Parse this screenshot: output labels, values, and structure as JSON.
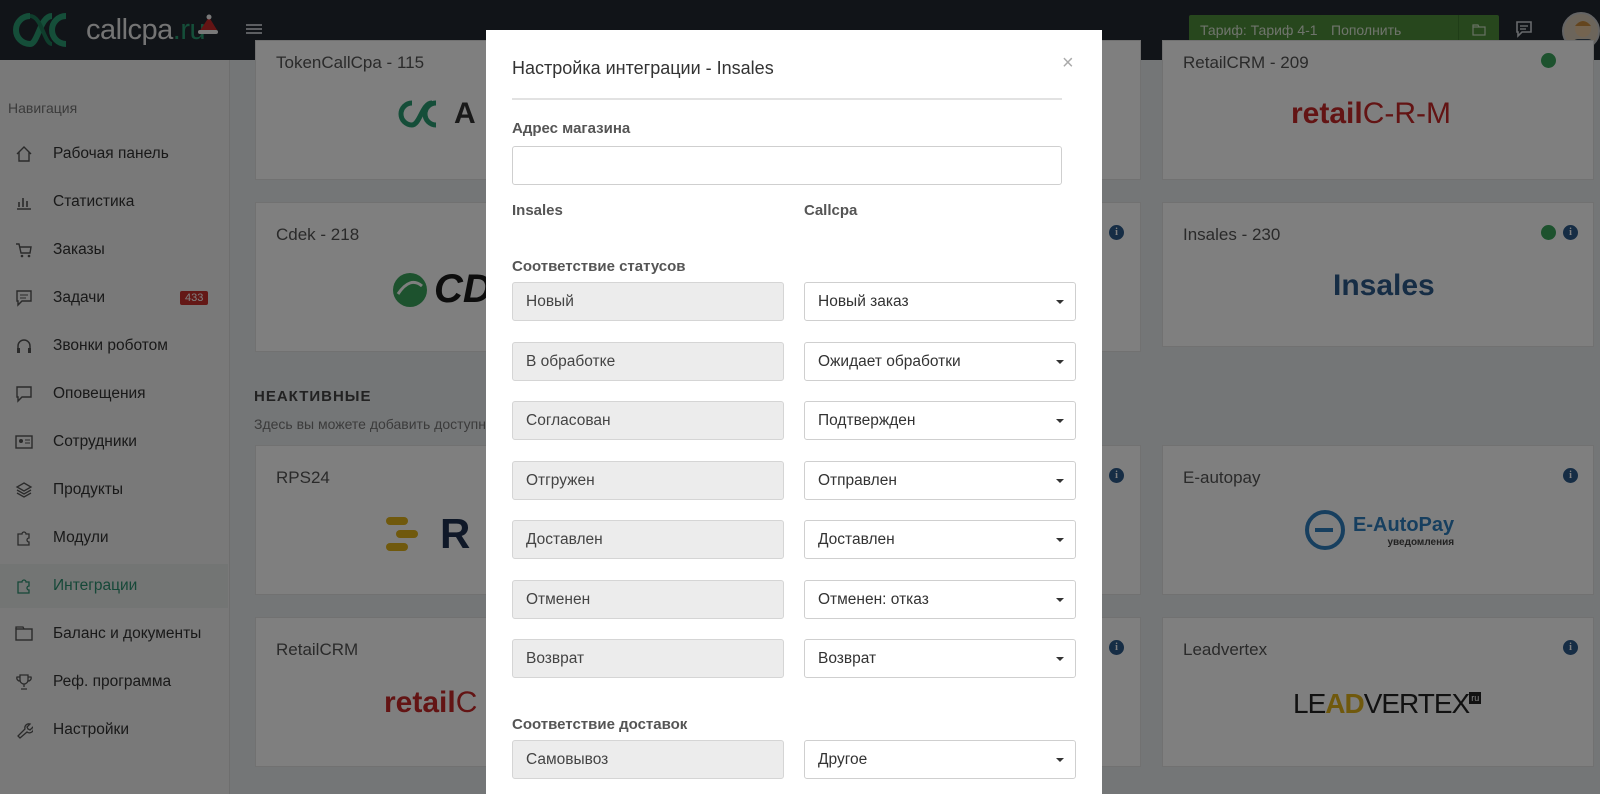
{
  "header": {
    "logo_text": "callcpa",
    "logo_ru": ".ru",
    "tarif_label": "Тариф: Тариф 4-1",
    "topup_label": "Пополнить баланс"
  },
  "sidebar": {
    "title": "Навигация",
    "items": [
      {
        "label": "Рабочая панель",
        "icon": "home-icon"
      },
      {
        "label": "Статистика",
        "icon": "chart-icon"
      },
      {
        "label": "Заказы",
        "icon": "cart-icon"
      },
      {
        "label": "Задачи",
        "icon": "chat-icon",
        "badge": "433"
      },
      {
        "label": "Звонки роботом",
        "icon": "headphones-icon"
      },
      {
        "label": "Оповещения",
        "icon": "message-icon"
      },
      {
        "label": "Сотрудники",
        "icon": "id-card-icon"
      },
      {
        "label": "Продукты",
        "icon": "layers-icon"
      },
      {
        "label": "Модули",
        "icon": "puzzle-icon"
      },
      {
        "label": "Интеграции",
        "icon": "plug-icon",
        "active": true
      },
      {
        "label": "Баланс и документы",
        "icon": "wallet-icon"
      },
      {
        "label": "Реф. программа",
        "icon": "trophy-icon"
      },
      {
        "label": "Настройки",
        "icon": "wrench-icon"
      }
    ]
  },
  "cards": {
    "tokencallcpa": "TokenCallCpa - 115",
    "retailcrm209": "RetailCRM - 209",
    "cdek": "Cdek - 218",
    "insales230": "Insales - 230",
    "insales_logo": "Insales",
    "rps24": "RPS24",
    "eautopay": "E-autopay",
    "eautopay_logo": "E-AutoPay",
    "eautopay_sub": "уведомления",
    "retailcrm": "RetailCRM",
    "leadvertex": "Leadvertex",
    "leadvertex_logo_a": "LE",
    "leadvertex_logo_b": "AD",
    "leadvertex_logo_c": "VERTEX",
    "leadvertex_logo_ru": "ru",
    "retail_logo_a": "retail",
    "retail_logo_b": "C-R-M",
    "cdek_logo": "CD",
    "rps_logo": "R",
    "token_logo": "A"
  },
  "inactive_section": {
    "title": "НЕАКТИВНЫЕ",
    "desc": "Здесь вы можете добавить доступн"
  },
  "modal": {
    "title": "Настройка интеграции - Insales",
    "close": "×",
    "address_label": "Адрес магазина",
    "address_value": "",
    "col_left": "Insales",
    "col_right": "Callcpa",
    "status_section": "Соответствие статусов",
    "statuses": [
      {
        "insales": "Новый",
        "callcpa": "Новый заказ"
      },
      {
        "insales": "В обработке",
        "callcpa": "Ожидает обработки"
      },
      {
        "insales": "Согласован",
        "callcpa": "Подтвержден"
      },
      {
        "insales": "Отгружен",
        "callcpa": "Отправлен"
      },
      {
        "insales": "Доставлен",
        "callcpa": "Доставлен"
      },
      {
        "insales": "Отменен",
        "callcpa": "Отменен: отказ"
      },
      {
        "insales": "Возврат",
        "callcpa": "Возврат"
      }
    ],
    "delivery_section": "Соответствие доставок",
    "deliveries": [
      {
        "insales": "Самовывоз",
        "callcpa": "Другое"
      }
    ]
  },
  "colors": {
    "accent": "#2d9070",
    "header_bg": "#222831",
    "button_green": "#4e8f3a",
    "badge_red": "#c9302c"
  }
}
